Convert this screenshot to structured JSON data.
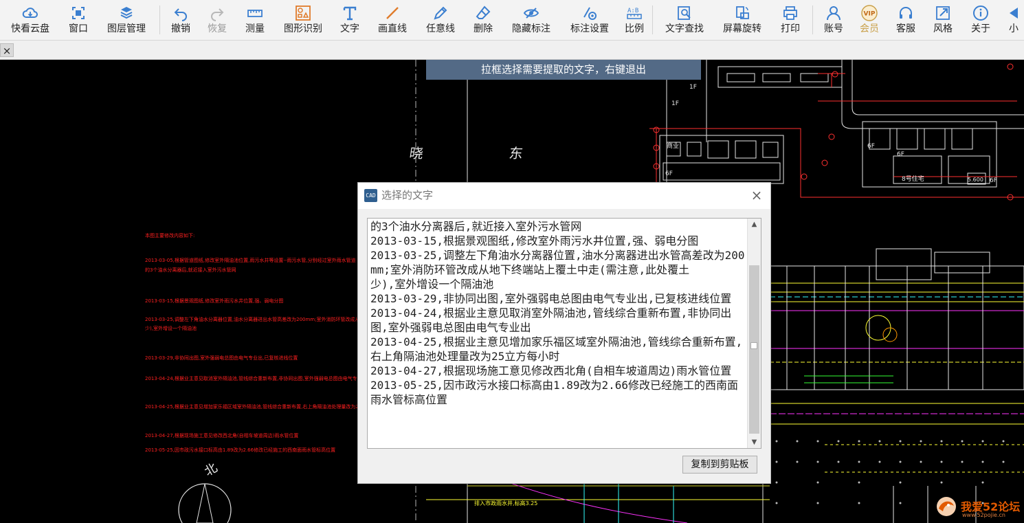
{
  "toolbar": {
    "items": [
      {
        "label": "快看云盘",
        "icon": "cloud-icon"
      },
      {
        "label": "窗口",
        "icon": "window-icon"
      },
      {
        "label": "图层管理",
        "icon": "layers-icon"
      },
      {
        "label": "撤销",
        "icon": "undo-icon"
      },
      {
        "label": "恢复",
        "icon": "redo-icon"
      },
      {
        "label": "测量",
        "icon": "ruler-icon"
      },
      {
        "label": "图形识别",
        "icon": "shape-recognition-icon"
      },
      {
        "label": "文字",
        "icon": "text-icon"
      },
      {
        "label": "画直线",
        "icon": "line-icon"
      },
      {
        "label": "任意线",
        "icon": "pen-icon"
      },
      {
        "label": "删除",
        "icon": "eraser-icon"
      },
      {
        "label": "隐藏标注",
        "icon": "hide-eye-icon"
      },
      {
        "label": "标注设置",
        "icon": "annotation-settings-icon"
      },
      {
        "label": "比例",
        "icon": "scale-icon"
      },
      {
        "label": "文字查找",
        "icon": "text-search-icon"
      },
      {
        "label": "屏幕旋转",
        "icon": "rotate-screen-icon"
      },
      {
        "label": "打印",
        "icon": "printer-icon"
      },
      {
        "label": "账号",
        "icon": "user-icon"
      },
      {
        "label": "会员",
        "icon": "vip-icon",
        "badge": "VIP"
      },
      {
        "label": "客服",
        "icon": "headset-icon"
      },
      {
        "label": "风格",
        "icon": "style-icon"
      },
      {
        "label": "关于",
        "icon": "info-icon"
      },
      {
        "label": "小",
        "icon": "minimize-icon"
      }
    ]
  },
  "tabbar": {
    "close_glyph": "×"
  },
  "hint": {
    "text": "拉框选择需要提取的文字，右键退出"
  },
  "dialog": {
    "title": "选择的文字",
    "icon_text": "CAD",
    "close_glyph": "×",
    "text": "的3个油水分离器后,就近接入室外污水管网\n2013-03-15,根据景观图纸,修改室外雨污水井位置,强、弱电分图\n2013-03-25,调整左下角油水分离器位置,油水分离器进出水管高差改为200mm;室外消防环管改成从地下终端站上覆土中走(需注意,此处覆土\n少),室外增设一个隔油池\n2013-03-29,非协同出图,室外强弱电总图由电气专业出,已复核进线位置\n2013-04-24,根据业主意见取消室外隔油池,管线综合重新布置,非协同出图,室外强弱电总图由电气专业出\n2013-04-25,根据业主意见增加家乐福区域室外隔油池,管线综合重新布置,右上角隔油池处理量改为25立方每小时\n2013-04-27,根据现场施工意见修改西北角(自相车坡道周边)雨水管位置\n2013-05-25,因市政污水接口标高由1.89改为2.66修改已经施工的西南面雨水管标高位置",
    "copy_button": "复制到剪贴板"
  },
  "cad_drawing": {
    "note_heading": "本图主要修改内容如下:",
    "notes": [
      "2013-03-05,根据管道图纸,修改室外隔油池位置,雨污水井等设置--雨污水管,分别经过室外雨水管道",
      "的3个油水分离器后,就近接入室外污水管网",
      "2013-03-15,根据景观图纸,修改室外雨污水井位置,强、弱电分图",
      "2013-03-25,调整左下角油水分离器位置,油水分离器进出水管高差改为200mm;室外消防环管改成从地下终端站上覆土中走",
      "少),室外增设一个隔油池",
      "2013-03-29,非协同出图,室外强弱电总图由电气专业出,已复核进线位置",
      "2013-04-24,根据业主意见取消室外隔油池,管线综合重新布置,非协同出图,室外强弱电总图由电气专业出",
      "2013-04-25,根据业主意见增加家乐福区域室外隔油池,管线综合重新布置,右上角隔油池处理量改为25立方每小时",
      "2013-04-27,根据现场施工意见修改西北角(自相车坡道周边)雨水管位置",
      "2013-05-25,因市政污水接口标高由1.89改为2.66修改已经施工的西南面雨水管标高位置"
    ],
    "labels": {
      "street_a": "晓",
      "street_b": "东",
      "north": "北",
      "floor_1f_a": "1F",
      "floor_1f_b": "1F",
      "floor_6f_a": "6F",
      "floor_6f_b": "6F",
      "floor_6f_c": "6F",
      "floor_6f_d": "6F",
      "commercial": "商业",
      "building8": "8号住宅",
      "elevation": "5.600",
      "pipe_note": "排入市政雨水井,标高3.25"
    },
    "colors": {
      "note_red": "#ff2020",
      "line_white": "#e6e6e6",
      "line_red": "#ff3030",
      "line_yellow": "#ffff33",
      "line_magenta": "#ff33ff",
      "line_cyan": "#33ffff",
      "line_green": "#33ff33"
    }
  },
  "watermark": {
    "text": "我爱52论坛",
    "url": "www.52pojie.cn"
  }
}
